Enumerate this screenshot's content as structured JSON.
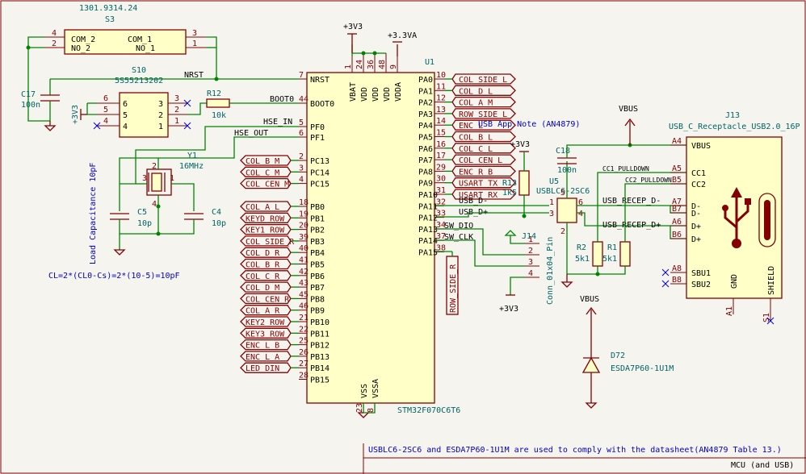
{
  "top_label": "1301.9314.24",
  "footer_note": "USBLC6-2SC6 and ESDA7P60-1U1M are used to comply with the datasheet(AN4879 Table 13.)",
  "sheet_title": "MCU (and USB)",
  "app_note": "USB App Note (AN4879)",
  "cl_formula": "CL=2*(CL0-Cs)=2*(10-5)=10pF",
  "load_cap_label": "Load Capacitance 10pF",
  "components": {
    "s3": {
      "ref": "S3",
      "com2": "COM_2",
      "no2": "NO_2",
      "com1": "COM_1",
      "no1": "NO_1",
      "p4": "4",
      "p2": "2",
      "p3": "3",
      "p1": "1"
    },
    "s10": {
      "ref": "S10",
      "value": "5S55213202",
      "p6": "6",
      "p5": "5",
      "p4": "4",
      "p3": "3",
      "p2": "2",
      "p1": "1"
    },
    "c17": {
      "ref": "C17",
      "value": "100n"
    },
    "r12": {
      "ref": "R12",
      "value": "10k"
    },
    "y1": {
      "ref": "Y1",
      "value": "16MHz",
      "p3": "3",
      "p1": "1",
      "p2": "2",
      "p4": "4"
    },
    "c5": {
      "ref": "C5",
      "value": "10p"
    },
    "c4": {
      "ref": "C4",
      "value": "10p"
    },
    "u1": {
      "ref": "U1",
      "value": "STM32F070C6T6"
    },
    "r13": {
      "ref": "R13",
      "value": "1k5"
    },
    "c18": {
      "ref": "C18",
      "value": "100n"
    },
    "u5": {
      "ref": "U5",
      "value": "USBLC6-2SC6"
    },
    "j14": {
      "ref": "J14",
      "value": "Conn_01x04_Pin"
    },
    "r2": {
      "ref": "R2",
      "value": "5k1"
    },
    "r1": {
      "ref": "R1",
      "value": "5k1"
    },
    "d72": {
      "ref": "D72",
      "value": "ESDA7P60-1U1M"
    },
    "j13": {
      "ref": "J13",
      "value": "USB_C_Receptacle_USB2.0_16P"
    }
  },
  "power": {
    "v3a": "+3V3",
    "v3b": "+3V3",
    "v3c": "+3V3",
    "v3d": "+3V3",
    "v33a": "+3.3VA",
    "vbus1": "VBUS",
    "vbus2": "VBUS"
  },
  "mcu_top_pins": {
    "names": [
      "VBAT",
      "VDD",
      "VDD",
      "VDD",
      "VDDA"
    ],
    "nums": [
      "1",
      "24",
      "36",
      "48",
      "9"
    ]
  },
  "mcu_bot_pins": {
    "names": [
      "VSS",
      "VSSA"
    ],
    "nums": [
      "23",
      "8"
    ]
  },
  "mcu_left_top": {
    "names": [
      "NRST",
      "BOOT0",
      "PF0",
      "PF1"
    ],
    "nums": [
      "7",
      "44",
      "5",
      "6"
    ]
  },
  "mcu_left_pc": {
    "names": [
      "PC13",
      "PC14",
      "PC15"
    ],
    "nums": [
      "2",
      "3",
      "4"
    ]
  },
  "mcu_left_pb": {
    "names": [
      "PB0",
      "PB1",
      "PB2",
      "PB3",
      "PB4",
      "PB5",
      "PB6",
      "PB7",
      "PB8",
      "PB9",
      "PB10",
      "PB11",
      "PB12",
      "PB13",
      "PB14",
      "PB15"
    ],
    "nums": [
      "18",
      "19",
      "20",
      "39",
      "40",
      "41",
      "42",
      "43",
      "45",
      "46",
      "21",
      "22",
      "25",
      "26",
      "27",
      "28"
    ]
  },
  "mcu_right": {
    "names": [
      "PA0",
      "PA1",
      "PA2",
      "PA3",
      "PA4",
      "PA5",
      "PA6",
      "PA7",
      "PA8",
      "PA9",
      "PA10",
      "PA11",
      "PA12",
      "PA13",
      "PA14",
      "PA15"
    ],
    "nums": [
      "10",
      "11",
      "12",
      "13",
      "14",
      "15",
      "16",
      "17",
      "29",
      "30",
      "31",
      "32",
      "33",
      "34",
      "37",
      "38"
    ]
  },
  "left_labels_pc": [
    "COL_B_M",
    "COL_C_M",
    "COL_CEN_M"
  ],
  "left_labels_pb": [
    "COL_A_L",
    "KEYD_ROW",
    "KEY1_ROW",
    "COL_SIDE_R",
    "COL_D_R",
    "COL_B_R",
    "COL_C_R",
    "COL_D_M",
    "COL_CEN_R",
    "COL_A_R",
    "KEY2_ROW",
    "KEY3_ROW",
    "ENC_L_B",
    "ENC_L_A",
    "LED_DIN"
  ],
  "right_labels": [
    "COL_SIDE_L",
    "COL_D_L",
    "COL_A_M",
    "ROW_SIDE_L",
    "ENC_L",
    "COL_B_L",
    "COL_C_L",
    "COL_CEN_L",
    "ENC_R_B",
    "USART_TX",
    "USART_RX"
  ],
  "row_side_r": "ROW_SIDE_R",
  "nets": {
    "nrst": "NRST",
    "boot0": "BOOT0",
    "hse_in": "HSE_IN",
    "hse_out": "HSE_OUT",
    "usb_dm": "USB_D-",
    "usb_dp": "USB_D+",
    "sw_dio": "SW_DIO",
    "sw_clk": "SW_CLK",
    "recep_dm": "USB_RECEP_D-",
    "recep_dp": "USB_RECEP_D+",
    "cc1_pulldown": "CC1_PULLDOWN",
    "cc2_pulldown": "CC2_PULLDOWN"
  },
  "u5_pins": [
    "1",
    "6",
    "3",
    "4",
    "2",
    "5"
  ],
  "j14_pins": [
    "1",
    "2",
    "3",
    "4"
  ],
  "j13_pins": {
    "names": [
      "VBUS",
      "CC1",
      "CC2",
      "D-",
      "D-",
      "D+",
      "D+",
      "SBU1",
      "SBU2"
    ],
    "nums": [
      "A4",
      "A5",
      "B5",
      "A7",
      "B7",
      "A6",
      "B6",
      "A8",
      "B8"
    ],
    "gnd": "GND",
    "shield": "SHIELD",
    "a1": "A1",
    "s1": "S1"
  }
}
